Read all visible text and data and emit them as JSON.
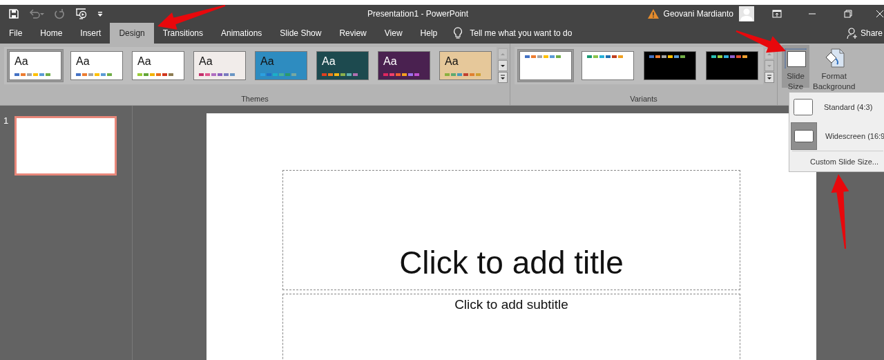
{
  "window": {
    "title": "Presentation1  -  PowerPoint",
    "user": "Geovani Mardianto"
  },
  "tabs": [
    {
      "label": "File",
      "selected": false
    },
    {
      "label": "Home",
      "selected": false
    },
    {
      "label": "Insert",
      "selected": false
    },
    {
      "label": "Design",
      "selected": true
    },
    {
      "label": "Transitions",
      "selected": false
    },
    {
      "label": "Animations",
      "selected": false
    },
    {
      "label": "Slide Show",
      "selected": false
    },
    {
      "label": "Review",
      "selected": false
    },
    {
      "label": "View",
      "selected": false
    },
    {
      "label": "Help",
      "selected": false
    }
  ],
  "tell_me": {
    "placeholder": "Tell me what you want to do"
  },
  "share": "Share",
  "themes": {
    "label": "Themes",
    "items": [
      {
        "label": "Aa",
        "selected": true,
        "color": "#ffffff"
      },
      {
        "label": "Aa",
        "selected": false,
        "color": "#ffffff"
      },
      {
        "label": "Aa",
        "selected": false,
        "color": "#ffffff"
      },
      {
        "label": "Aa",
        "selected": false,
        "color": "#f1ecea"
      },
      {
        "label": "Aa",
        "selected": false,
        "color": "#2e8cc0"
      },
      {
        "label": "Aa",
        "selected": false,
        "color": "#1d4a4f"
      },
      {
        "label": "Aa",
        "selected": false,
        "color": "#4a2150"
      },
      {
        "label": "Aa",
        "selected": false,
        "color": "#e6c89a"
      }
    ]
  },
  "variants": {
    "label": "Variants",
    "items": [
      {
        "selected": true,
        "color": "#ffffff"
      },
      {
        "selected": false,
        "color": "#ffffff"
      },
      {
        "selected": false,
        "color": "#000000"
      },
      {
        "selected": false,
        "color": "#000000"
      }
    ]
  },
  "slide_size": {
    "label": "Slide Size",
    "expanded": true
  },
  "format_background": {
    "label": "Format Background"
  },
  "slide_size_menu": [
    {
      "label": "Standard (4:3)",
      "selected": false
    },
    {
      "label": "Widescreen (16:9",
      "selected": true
    }
  ],
  "custom_slide_size": "Custom Slide Size...",
  "slides": [
    {
      "number": "1",
      "selected": true
    }
  ],
  "slide": {
    "title_placeholder": "Click to add title",
    "subtitle_placeholder": "Click to add subtitle"
  }
}
